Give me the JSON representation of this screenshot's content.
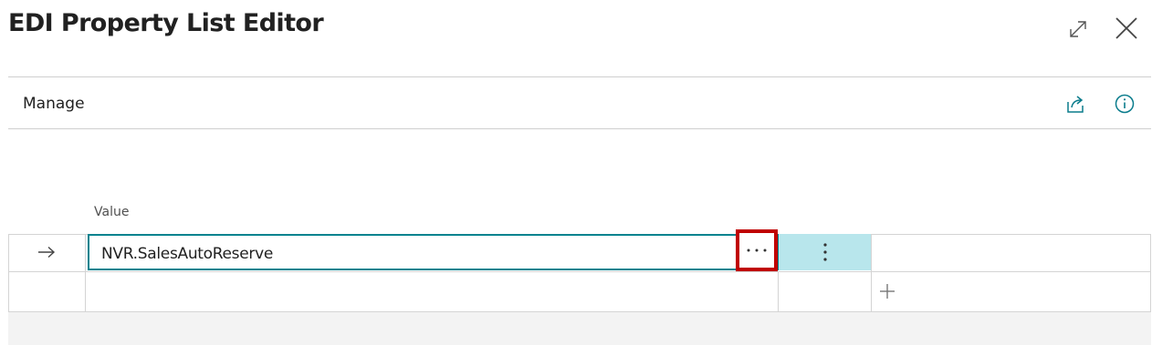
{
  "dialog": {
    "title": "EDI Property List Editor",
    "expand_icon": "expand-icon",
    "close_icon": "close-icon"
  },
  "action_bar": {
    "manage_label": "Manage",
    "share_icon": "share-icon",
    "info_icon": "info-icon"
  },
  "list": {
    "column_header": "Value",
    "rows": [
      {
        "indicator_icon": "arrow-right-icon",
        "value": "NVR.SalesAutoReserve",
        "selected": true
      },
      {
        "indicator_icon": "",
        "value": "",
        "selected": false
      }
    ],
    "lookup_icon": "ellipsis-horizontal-icon",
    "row_menu_icon": "ellipsis-vertical-icon",
    "add_icon": "plus-icon"
  },
  "colors": {
    "accent": "#00838f",
    "selected_row_cell": "#b8e6ec",
    "highlight_box": "#c00000",
    "footer_band": "#f3f3f3",
    "grid_line": "#d4d4d4"
  }
}
